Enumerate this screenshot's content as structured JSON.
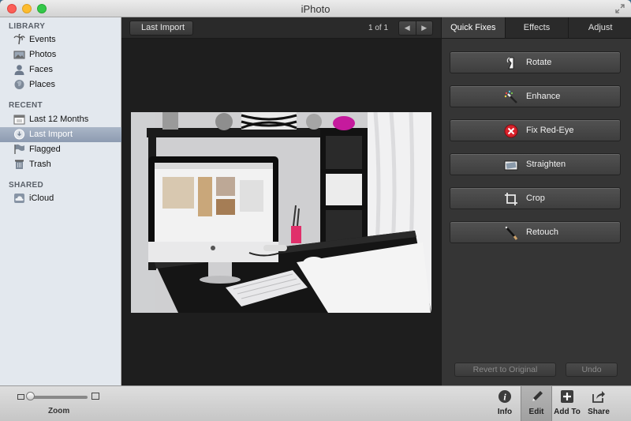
{
  "window": {
    "title": "iPhoto"
  },
  "sidebar": {
    "sections": [
      {
        "header": "LIBRARY",
        "items": [
          {
            "label": "Events",
            "icon": "palm-tree-icon"
          },
          {
            "label": "Photos",
            "icon": "photos-icon"
          },
          {
            "label": "Faces",
            "icon": "face-icon"
          },
          {
            "label": "Places",
            "icon": "globe-icon"
          }
        ]
      },
      {
        "header": "RECENT",
        "items": [
          {
            "label": "Last 12 Months",
            "icon": "calendar-icon"
          },
          {
            "label": "Last Import",
            "icon": "import-clock-icon",
            "selected": true
          },
          {
            "label": "Flagged",
            "icon": "flag-icon"
          },
          {
            "label": "Trash",
            "icon": "trash-icon"
          }
        ]
      },
      {
        "header": "SHARED",
        "items": [
          {
            "label": "iCloud",
            "icon": "icloud-icon"
          }
        ]
      }
    ]
  },
  "viewer": {
    "back_label": "Last Import",
    "counter": "1 of 1"
  },
  "panel": {
    "tabs": [
      {
        "label": "Quick Fixes",
        "active": true
      },
      {
        "label": "Effects"
      },
      {
        "label": "Adjust"
      }
    ],
    "quick_fixes": [
      {
        "label": "Rotate",
        "icon": "rotate-icon"
      },
      {
        "label": "Enhance",
        "icon": "magic-wand-icon"
      },
      {
        "label": "Fix Red-Eye",
        "icon": "red-eye-icon"
      },
      {
        "label": "Straighten",
        "icon": "straighten-icon"
      },
      {
        "label": "Crop",
        "icon": "crop-icon"
      },
      {
        "label": "Retouch",
        "icon": "retouch-brush-icon"
      }
    ],
    "revert_label": "Revert to Original",
    "undo_label": "Undo"
  },
  "bottombar": {
    "zoom_label": "Zoom",
    "zoom_level": 0.0,
    "buttons": [
      {
        "label": "Info",
        "icon": "info-icon"
      },
      {
        "label": "Edit",
        "icon": "pencil-icon",
        "active": true
      },
      {
        "label": "Add To",
        "icon": "plus-icon"
      },
      {
        "label": "Share",
        "icon": "share-icon"
      }
    ]
  }
}
